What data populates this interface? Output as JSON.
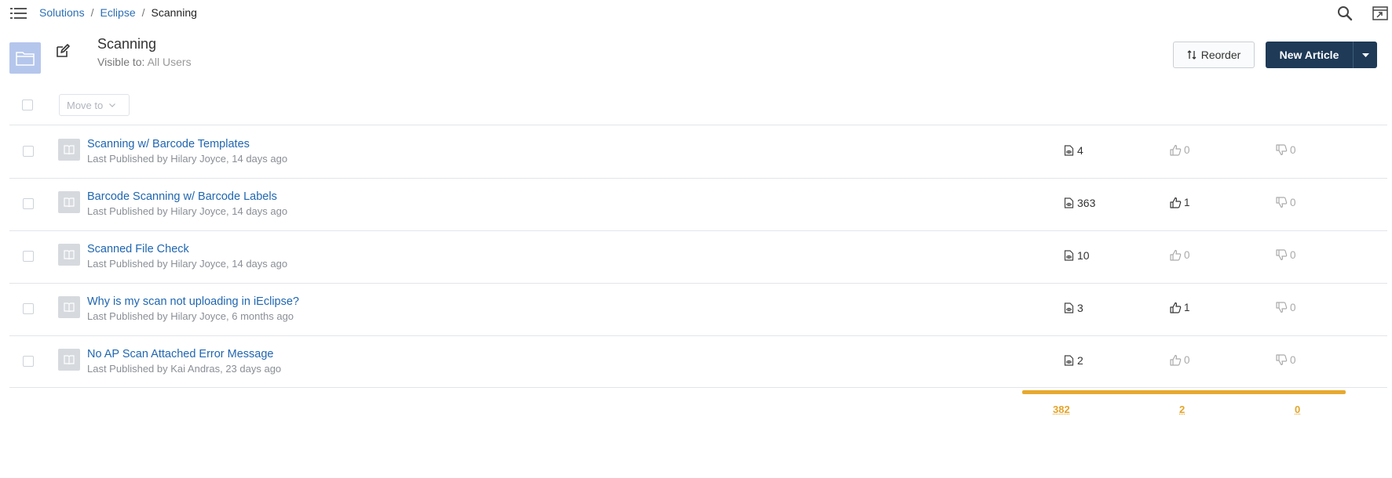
{
  "breadcrumb": {
    "items": [
      "Solutions",
      "Eclipse"
    ],
    "current": "Scanning"
  },
  "folder": {
    "title": "Scanning",
    "visibility_label": "Visible to:",
    "visibility_value": "All Users"
  },
  "toolbar": {
    "reorder_label": "Reorder",
    "new_article_label": "New Article",
    "move_to_label": "Move to"
  },
  "articles": [
    {
      "title": "Scanning w/ Barcode Templates",
      "meta": "Last Published by Hilary Joyce, 14 days ago",
      "views": "4",
      "likes": "0",
      "dislikes": "0",
      "liked": false
    },
    {
      "title": "Barcode Scanning w/ Barcode Labels",
      "meta": "Last Published by Hilary Joyce, 14 days ago",
      "views": "363",
      "likes": "1",
      "dislikes": "0",
      "liked": true
    },
    {
      "title": "Scanned File Check",
      "meta": "Last Published by Hilary Joyce, 14 days ago",
      "views": "10",
      "likes": "0",
      "dislikes": "0",
      "liked": false
    },
    {
      "title": "Why is my scan not uploading in iEclipse?",
      "meta": "Last Published by Hilary Joyce, 6 months ago",
      "views": "3",
      "likes": "1",
      "dislikes": "0",
      "liked": true
    },
    {
      "title": "No AP Scan Attached Error Message",
      "meta": "Last Published by Kai Andras, 23 days ago",
      "views": "2",
      "likes": "0",
      "dislikes": "0",
      "liked": false
    }
  ],
  "totals": {
    "views": "382",
    "likes": "2",
    "dislikes": "0"
  },
  "colors": {
    "link": "#1f66b0",
    "primary_button": "#1e3a57",
    "folder_tile": "#b5c6ec",
    "totals_accent": "#e7a930"
  }
}
